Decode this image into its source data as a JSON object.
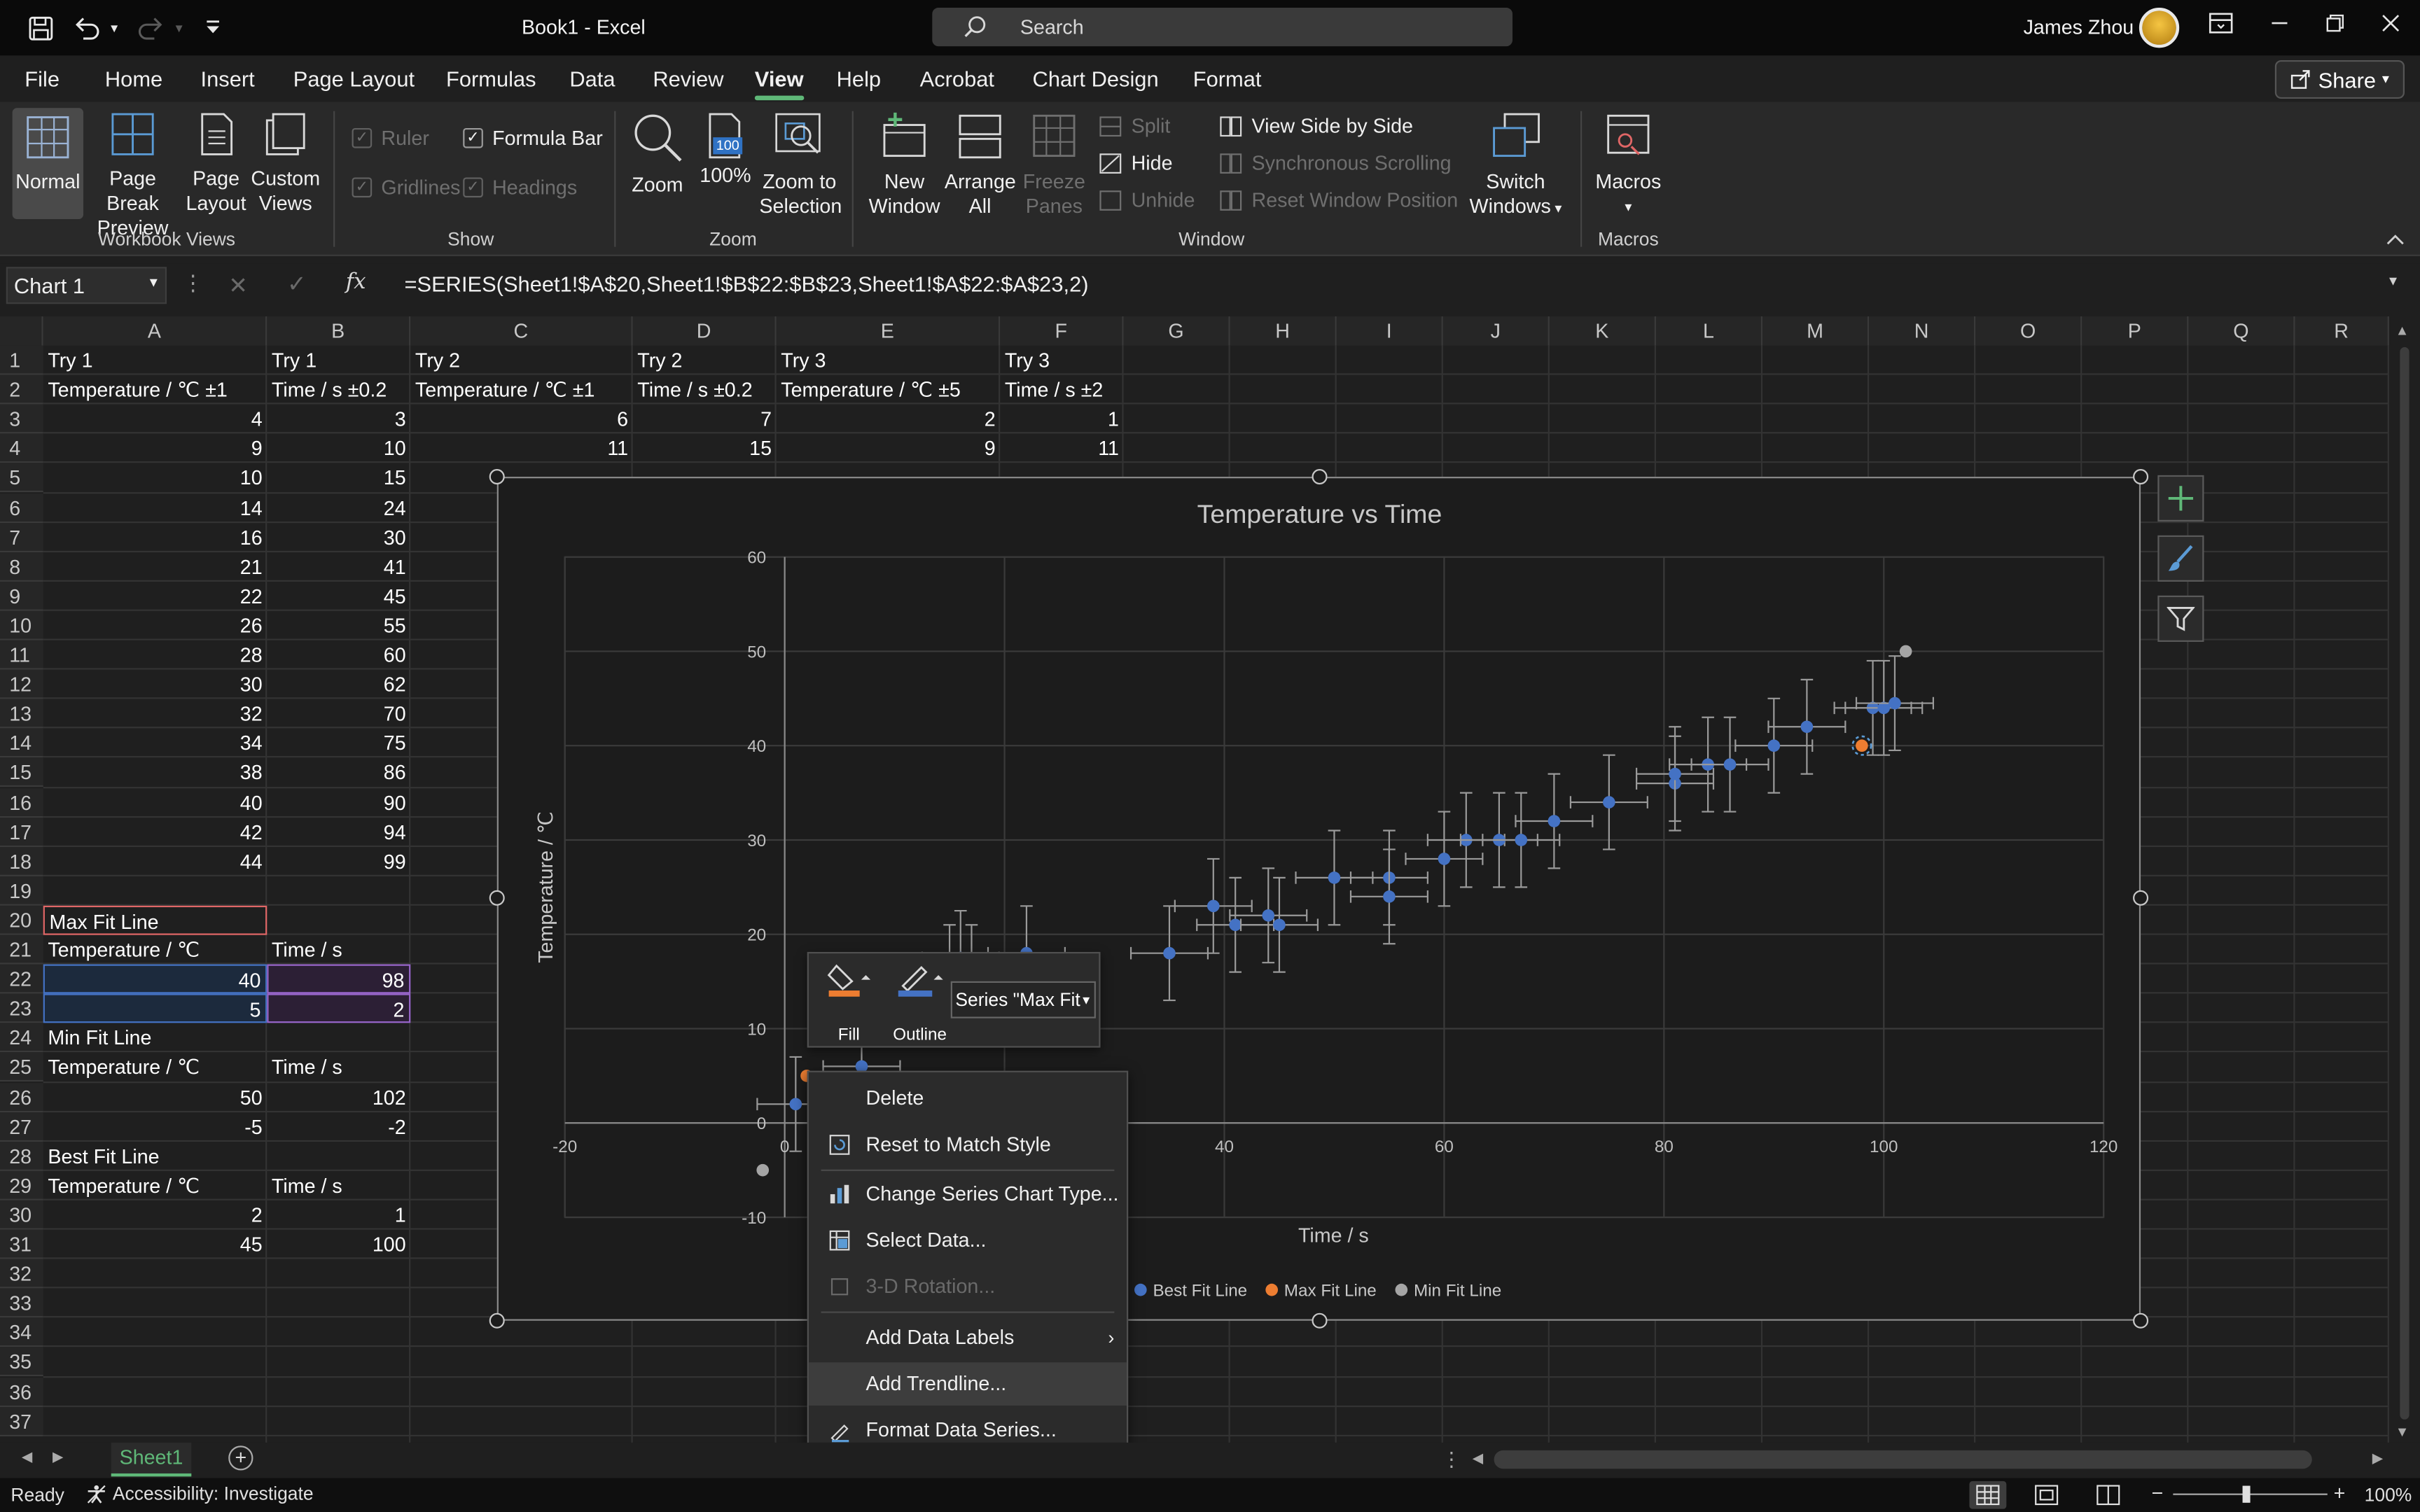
{
  "window": {
    "title": "Book1  -  Excel",
    "search_placeholder": "Search",
    "user_name": "James Zhou"
  },
  "menu": {
    "tabs": [
      "File",
      "Home",
      "Insert",
      "Page Layout",
      "Formulas",
      "Data",
      "Review",
      "View",
      "Help",
      "Acrobat",
      "Chart Design",
      "Format"
    ],
    "active_tab": "View",
    "share_label": "Share"
  },
  "ribbon": {
    "workbook_views": {
      "label": "Workbook Views",
      "normal": "Normal",
      "page_break_1": "Page Break",
      "page_break_2": "Preview",
      "page_layout_1": "Page",
      "page_layout_2": "Layout",
      "custom_1": "Custom",
      "custom_2": "Views"
    },
    "show": {
      "label": "Show",
      "ruler": "Ruler",
      "formula_bar": "Formula Bar",
      "gridlines": "Gridlines",
      "headings": "Headings"
    },
    "zoom": {
      "label": "Zoom",
      "zoom": "Zoom",
      "hundred": "100%",
      "hundred_icon": "100",
      "selection_1": "Zoom to",
      "selection_2": "Selection"
    },
    "window": {
      "label": "Window",
      "new_1": "New",
      "new_2": "Window",
      "arrange_1": "Arrange",
      "arrange_2": "All",
      "freeze_1": "Freeze",
      "freeze_2": "Panes",
      "split": "Split",
      "hide": "Hide",
      "unhide": "Unhide",
      "side_by_side": "View Side by Side",
      "sync_scroll": "Synchronous Scrolling",
      "reset_pos": "Reset Window Position",
      "switch_1": "Switch",
      "switch_2": "Windows"
    },
    "macros": {
      "label": "Macros",
      "macros": "Macros"
    }
  },
  "formula_bar": {
    "name_box": "Chart 1",
    "fx": "fx",
    "formula": "=SERIES(Sheet1!$A$20,Sheet1!$B$22:$B$23,Sheet1!$A$22:$A$23,2)"
  },
  "sheet": {
    "columns": [
      "A",
      "B",
      "C",
      "D",
      "E",
      "F",
      "G",
      "H",
      "I",
      "J",
      "K",
      "L",
      "M",
      "N",
      "O",
      "P",
      "Q",
      "R"
    ],
    "rows": [
      "1",
      "2",
      "3",
      "4",
      "5",
      "6",
      "7",
      "8",
      "9",
      "10",
      "11",
      "12",
      "13",
      "14",
      "15",
      "16",
      "17",
      "18",
      "19",
      "20",
      "21",
      "22",
      "23",
      "24",
      "25",
      "26",
      "27",
      "28",
      "29",
      "30",
      "31",
      "32",
      "33",
      "34",
      "35",
      "36",
      "37"
    ],
    "row1": [
      "Try 1",
      "Try 1",
      "Try 2",
      "Try 2",
      "Try 3",
      "Try 3"
    ],
    "row2": [
      "Temperature / ℃ ±1",
      "Time / s ±0.2",
      "Temperature / ℃ ±1",
      "Time / s ±0.2",
      "Temperature / ℃ ±5",
      "Time / s ±2"
    ],
    "try1_a": [
      "4",
      "9",
      "10",
      "14",
      "16",
      "21",
      "22",
      "26",
      "28",
      "30",
      "32",
      "34",
      "38",
      "40",
      "42",
      "44"
    ],
    "try1_b": [
      "3",
      "10",
      "15",
      "24",
      "30",
      "41",
      "45",
      "55",
      "60",
      "62",
      "70",
      "75",
      "86",
      "90",
      "94",
      "99"
    ],
    "row3_cdef": [
      "6",
      "7",
      "2",
      "1"
    ],
    "row4_cdef": [
      "11",
      "15",
      "9",
      "11"
    ],
    "max_fit_title": "Max Fit Line",
    "max_fit_header": [
      "Temperature / ℃",
      "Time / s"
    ],
    "max_fit_rows": [
      [
        "40",
        "98"
      ],
      [
        "5",
        "2"
      ]
    ],
    "min_fit_title": "Min Fit Line",
    "min_fit_header": [
      "Temperature / ℃",
      "Time / s"
    ],
    "min_fit_rows": [
      [
        "50",
        "102"
      ],
      [
        "-5",
        "-2"
      ]
    ],
    "best_fit_title": "Best Fit Line",
    "best_fit_header": [
      "Temperature / ℃",
      "Time / s"
    ],
    "best_fit_rows": [
      [
        "2",
        "1"
      ],
      [
        "45",
        "100"
      ]
    ],
    "sheet_tab": "Sheet1"
  },
  "chart_data": {
    "type": "scatter",
    "title": "Temperature vs Time",
    "xlabel": "Time / s",
    "ylabel": "Temperature / ℃",
    "xlim": [
      -20,
      120
    ],
    "ylim": [
      -10,
      60
    ],
    "x_ticks": [
      "-20",
      "0",
      "20",
      "40",
      "60",
      "80",
      "100",
      "120"
    ],
    "y_ticks": [
      "-10",
      "0",
      "10",
      "20",
      "30",
      "40",
      "50",
      "60"
    ],
    "grid": true,
    "legend_position": "bottom",
    "series": [
      {
        "name": "Best Fit Line",
        "color": "#4472c4",
        "points": [
          [
            1,
            2
          ],
          [
            7,
            6
          ],
          [
            15,
            16
          ],
          [
            16,
            17.5
          ],
          [
            17,
            16
          ],
          [
            22,
            18
          ],
          [
            35,
            18
          ],
          [
            39,
            23
          ],
          [
            41,
            21
          ],
          [
            44,
            22
          ],
          [
            45,
            21
          ],
          [
            50,
            26
          ],
          [
            55,
            26
          ],
          [
            55,
            24
          ],
          [
            60,
            28
          ],
          [
            62,
            30
          ],
          [
            65,
            30
          ],
          [
            67,
            30
          ],
          [
            70,
            32
          ],
          [
            75,
            34
          ],
          [
            81,
            36
          ],
          [
            81,
            37
          ],
          [
            84,
            38
          ],
          [
            86,
            38
          ],
          [
            90,
            40
          ],
          [
            93,
            42
          ],
          [
            99,
            44
          ],
          [
            100,
            44
          ],
          [
            101,
            44.5
          ]
        ]
      },
      {
        "name": "Max Fit Line",
        "color": "#ed7d31",
        "points": [
          [
            98,
            40
          ],
          [
            2,
            5
          ]
        ]
      },
      {
        "name": "Min Fit Line",
        "color": "#a5a5a5",
        "points": [
          [
            102,
            50
          ],
          [
            -2,
            -5
          ]
        ]
      }
    ]
  },
  "mini_toolbar": {
    "fill": "Fill",
    "outline": "Outline",
    "series_select": "Series \"Max Fit"
  },
  "context_menu": {
    "delete": "Delete",
    "reset": "Reset to Match Style",
    "change_type": "Change Series Chart Type...",
    "select_data": "Select Data...",
    "rotation": "3-D Rotation...",
    "data_labels": "Add Data Labels",
    "trendline": "Add Trendline...",
    "format_series": "Format Data Series..."
  },
  "status": {
    "ready": "Ready",
    "accessibility": "Accessibility: Investigate",
    "zoom": "100%"
  },
  "colors": {
    "accent_green": "#5fb878",
    "series_blue": "#4472c4",
    "series_orange": "#ed7d31",
    "series_gray": "#a5a5a5"
  }
}
